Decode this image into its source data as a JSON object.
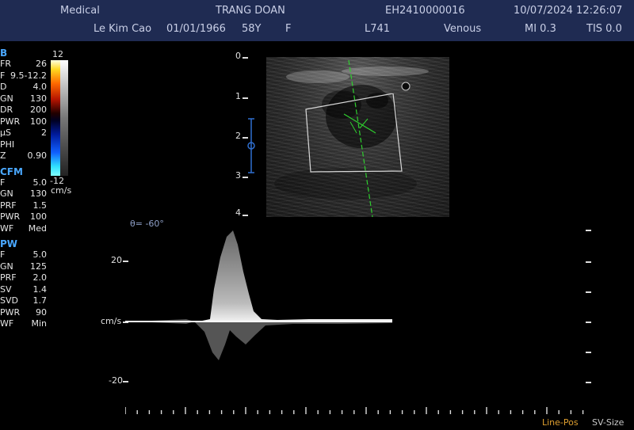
{
  "header": {
    "facility": "Medical",
    "patient_name_upper": "TRANG DOAN",
    "exam_id": "EH2410000016",
    "datetime": "10/07/2024 12:26:07",
    "operator": "Le Kim Cao",
    "dob": "01/01/1966",
    "age": "58Y",
    "sex": "F",
    "probe": "L741",
    "preset": "Venous",
    "mi": "MI 0.3",
    "tis": "TIS 0.0"
  },
  "panel": {
    "b_title": "B",
    "b_params": [
      {
        "k": "FR",
        "v": "26"
      },
      {
        "k": "F",
        "v": "9.5-12.2"
      },
      {
        "k": "D",
        "v": "4.0"
      },
      {
        "k": "GN",
        "v": "130"
      },
      {
        "k": "DR",
        "v": "200"
      },
      {
        "k": "PWR",
        "v": "100"
      },
      {
        "k": "µS",
        "v": "2"
      },
      {
        "k": "PHI",
        "v": ""
      },
      {
        "k": "Z",
        "v": "0.90"
      }
    ],
    "cfm_title": "CFM",
    "cfm_params": [
      {
        "k": "F",
        "v": "5.0"
      },
      {
        "k": "GN",
        "v": "130"
      },
      {
        "k": "PRF",
        "v": "1.5"
      },
      {
        "k": "PWR",
        "v": "100"
      },
      {
        "k": "WF",
        "v": "Med"
      }
    ],
    "pw_title": "PW",
    "pw_params": [
      {
        "k": "F",
        "v": "5.0"
      },
      {
        "k": "GN",
        "v": "125"
      },
      {
        "k": "PRF",
        "v": "2.0"
      },
      {
        "k": "SV",
        "v": "1.4"
      },
      {
        "k": "SVD",
        "v": "1.7"
      },
      {
        "k": "PWR",
        "v": "90"
      },
      {
        "k": "WF",
        "v": "Min"
      }
    ]
  },
  "colorbar": {
    "max": "12",
    "min": "-12",
    "unit": "cm/s"
  },
  "depth_scale": {
    "labels": [
      "0",
      "1",
      "2",
      "3",
      "4"
    ]
  },
  "doppler": {
    "angle": "θ= -60°",
    "velocity_labels": [
      "20",
      "cm/s",
      "-20"
    ]
  },
  "footer": {
    "line_pos": "Line-Pos",
    "sv_size": "SV-Size"
  },
  "colors": {
    "header_bg": "#1f2b52",
    "section": "#4aa8ff",
    "accent": "#f0a020",
    "flow_line": "#2fd02f"
  }
}
